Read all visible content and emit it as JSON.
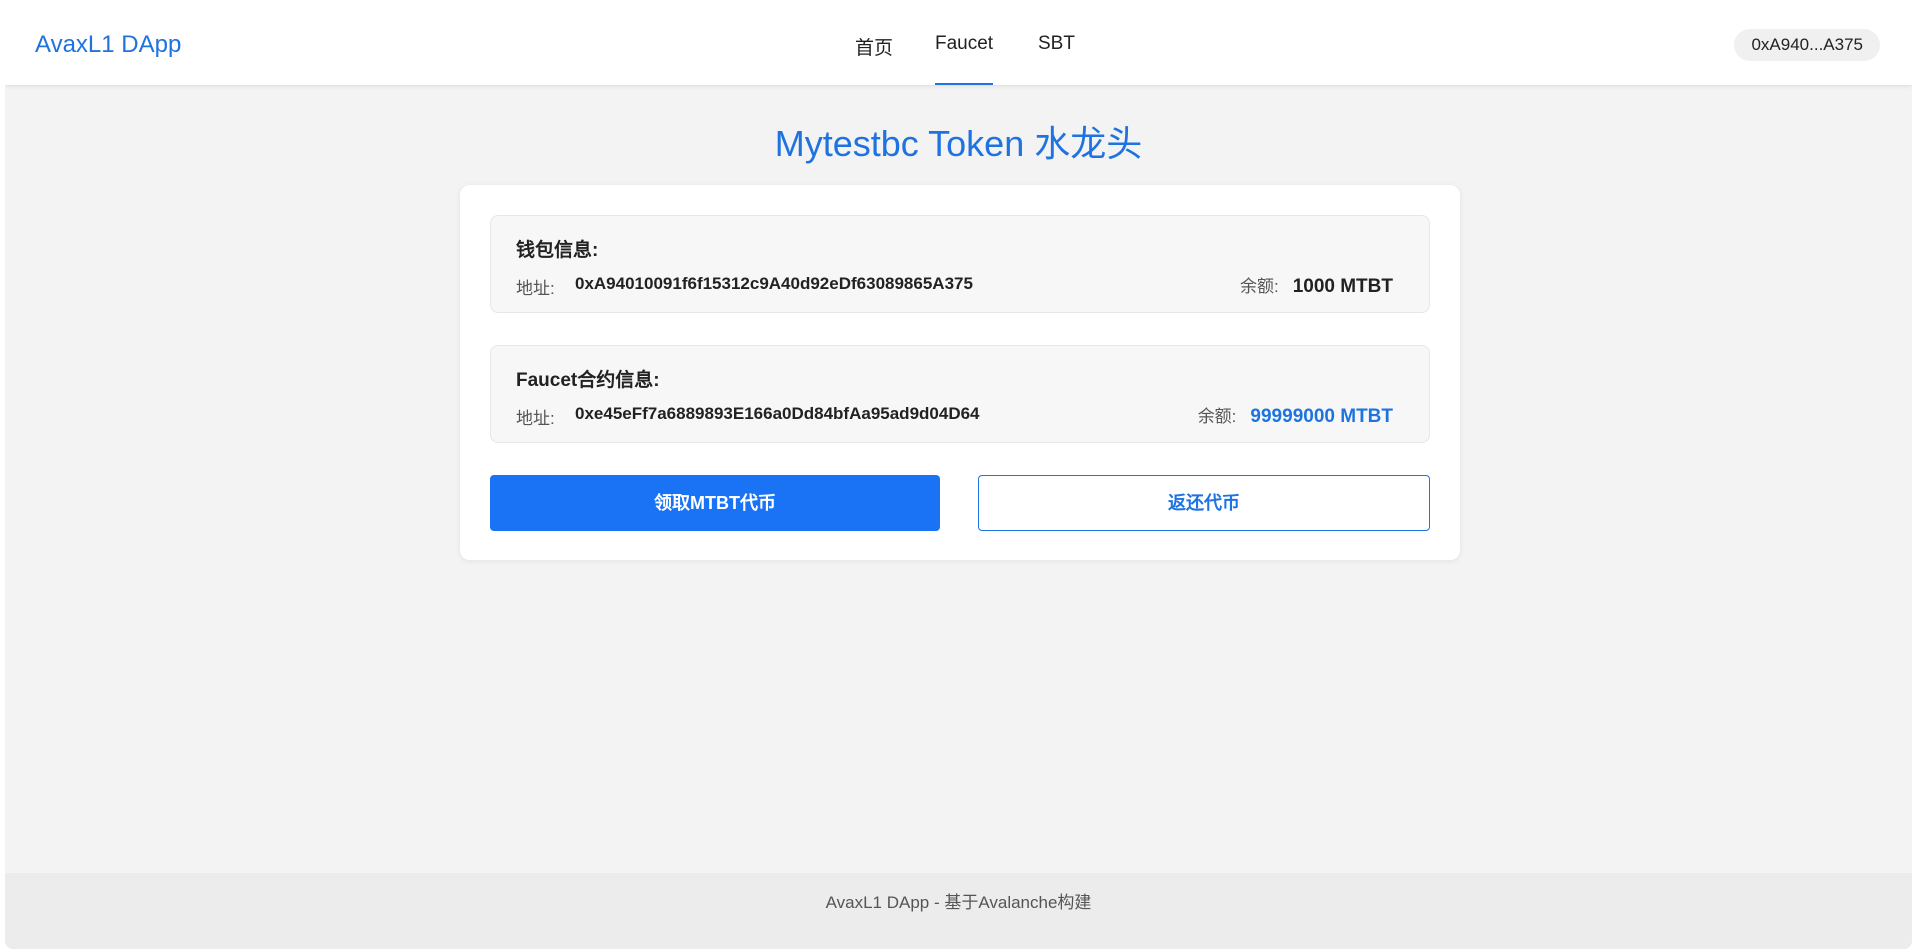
{
  "nav": {
    "brand": "AvaxL1 DApp",
    "links": [
      {
        "label": "首页"
      },
      {
        "label": "Faucet"
      },
      {
        "label": "SBT"
      }
    ],
    "wallet": "0xA940...A375"
  },
  "page": {
    "title": "Mytestbc Token 水龙头"
  },
  "wallet_info": {
    "title": "钱包信息:",
    "address_label": "地址:",
    "address": "0xA94010091f6f15312c9A40d92eDf63089865A375",
    "balance_label": "余额:",
    "balance": "1000 MTBT"
  },
  "faucet_info": {
    "title": "Faucet合约信息:",
    "address_label": "地址:",
    "address": "0xe45eFf7a6889893E166a0Dd84bfAa95ad9d04D64",
    "balance_label": "余额:",
    "balance": "99999000 MTBT"
  },
  "actions": {
    "claim_label": "领取MTBT代币",
    "return_label": "返还代币"
  },
  "footer": {
    "text": "AvaxL1 DApp - 基于Avalanche构建"
  },
  "colors": {
    "accent": "#1e73e0",
    "primary_button": "#1a73f5",
    "background": "#f3f3f3"
  }
}
